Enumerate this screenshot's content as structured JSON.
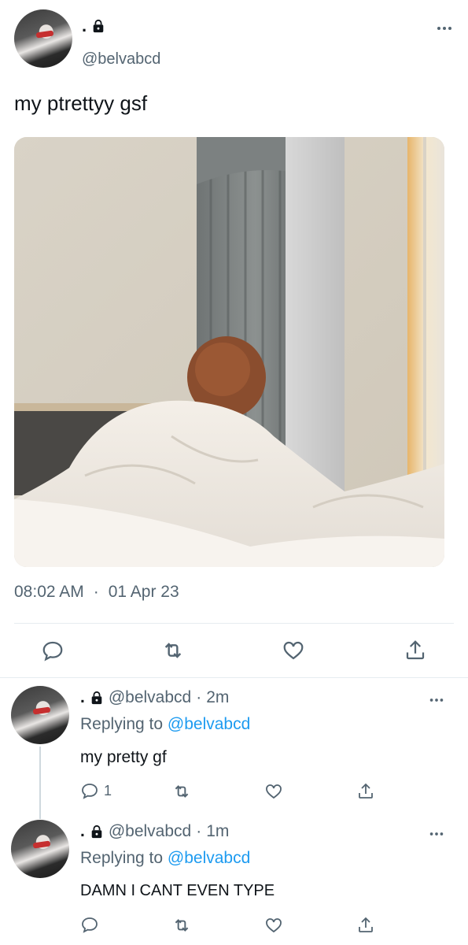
{
  "main_tweet": {
    "display_name": ".",
    "handle": "@belvabcd",
    "text": "my ptrettyy gsf",
    "time": "08:02 AM",
    "separator": "·",
    "date": "01 Apr 23"
  },
  "replies": [
    {
      "display_name": ".",
      "handle": "@belvabcd",
      "separator": "·",
      "time_ago": "2m",
      "replying_prefix": "Replying to",
      "replying_handle": "@belvabcd",
      "text": "my pretty gf",
      "reply_count": "1"
    },
    {
      "display_name": ".",
      "handle": "@belvabcd",
      "separator": "·",
      "time_ago": "1m",
      "replying_prefix": "Replying to",
      "replying_handle": "@belvabcd",
      "text": "DAMN I CANT EVEN TYPE",
      "reply_count": ""
    }
  ],
  "icons": {
    "more": "more-icon",
    "reply": "reply-icon",
    "retweet": "retweet-icon",
    "like": "like-icon",
    "share": "share-icon",
    "lock": "lock-icon"
  },
  "colors": {
    "text": "#0f1419",
    "muted": "#536471",
    "link": "#1d9bf0",
    "divider": "#e6ecf0"
  }
}
